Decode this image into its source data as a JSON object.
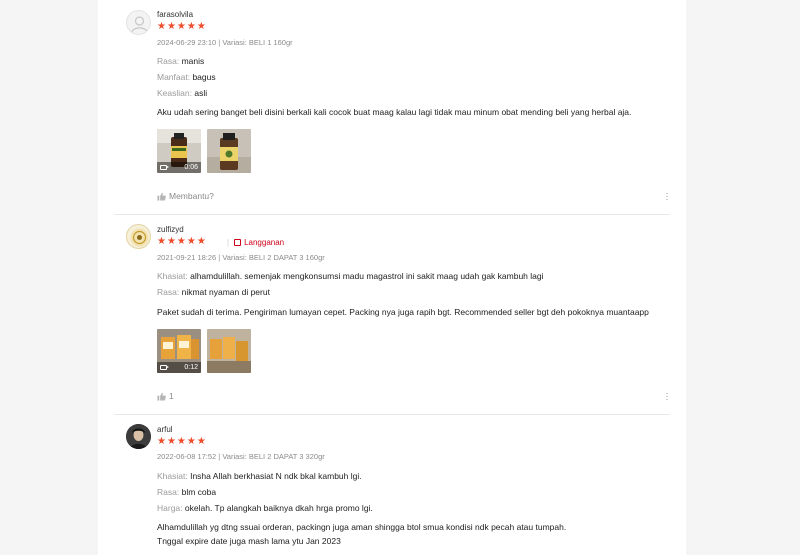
{
  "reviews": [
    {
      "username": "farasolvila",
      "stars": "★★★★★",
      "date_variant": "2024-06-29 23:10 | Variasi: BELI 1 160gr",
      "attributes": [
        {
          "key": "Rasa:",
          "value": "manis"
        },
        {
          "key": "Manfaat:",
          "value": "bagus"
        },
        {
          "key": "Keaslian:",
          "value": "asli"
        }
      ],
      "body_lines": [
        "Aku udah sering banget beli disini berkali kali cocok buat maag kalau lagi tidak mau minum obat mending beli yang herbal aja."
      ],
      "video_duration": "0:06",
      "helpful_label": "Membantu?",
      "more_icon": "more-vertical-icon"
    },
    {
      "username": "zulfizyd",
      "stars": "★★★★★",
      "subscription_label": "Langganan",
      "date_variant": "2021-09-21 18:26 | Variasi: BELI 2 DAPAT 3 160gr",
      "attributes": [
        {
          "key": "Khasiat:",
          "value": "alhamdulillah. semenjak mengkonsumsi madu magastrol ini sakit maag udah gak kambuh lagi"
        },
        {
          "key": "Rasa:",
          "value": "nikmat nyaman di perut"
        }
      ],
      "body_lines": [
        "Paket sudah di terima. Pengiriman lumayan cepet. Packing nya juga rapih bgt. Recommended seller bgt deh pokoknya muantaapp"
      ],
      "video_duration": "0:12",
      "helpful_count": "1",
      "more_icon": "more-vertical-icon"
    },
    {
      "username": "arful",
      "stars": "★★★★★",
      "date_variant": "2022-06-08 17:52 | Variasi: BELI 2 DAPAT 3 320gr",
      "attributes": [
        {
          "key": "Khasiat:",
          "value": "Insha Allah berkhasiat N ndk bkal kambuh lgi."
        },
        {
          "key": "Rasa:",
          "value": "blm coba"
        },
        {
          "key": "Harga:",
          "value": "okelah. Tp alangkah baiknya dkah hrga promo lgi."
        }
      ],
      "body_lines": [
        "Alhamdulillah yg dtng ssuai orderan, packingn juga aman shingga btol smua kondisi ndk pecah atau tumpah.",
        "Tnggal expire date juga mash lama ytu Jan 2023"
      ]
    }
  ],
  "colors": {
    "star": "#ee4d2d",
    "subscription": "#d0011b",
    "muted": "#9a9a9a"
  }
}
